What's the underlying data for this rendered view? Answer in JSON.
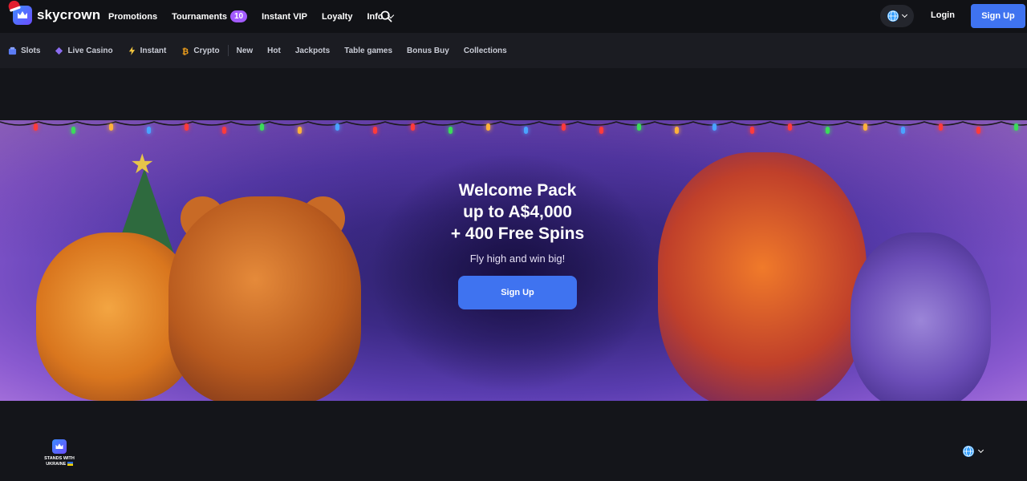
{
  "header": {
    "logo_text": "skycrown",
    "nav": [
      {
        "label": "Promotions"
      },
      {
        "label": "Tournaments",
        "badge": "10"
      },
      {
        "label": "Instant VIP"
      },
      {
        "label": "Loyalty"
      },
      {
        "label": "Info"
      }
    ],
    "login_label": "Login",
    "signup_label": "Sign Up"
  },
  "categories": [
    {
      "label": "Slots",
      "icon": "slots-icon"
    },
    {
      "label": "Live Casino",
      "icon": "live-casino-icon"
    },
    {
      "label": "Instant",
      "icon": "lightning-icon"
    },
    {
      "label": "Crypto",
      "icon": "bitcoin-icon"
    },
    {
      "label": "New"
    },
    {
      "label": "Hot"
    },
    {
      "label": "Jackpots"
    },
    {
      "label": "Table games"
    },
    {
      "label": "Bonus Buy"
    },
    {
      "label": "Collections"
    }
  ],
  "hero": {
    "title_line1": "Welcome Pack",
    "title_line2": "up to A$4,000",
    "title_line3": "+ 400 Free Spins",
    "subtitle": "Fly high and win big!",
    "cta_label": "Sign Up"
  },
  "footer": {
    "ukraine_line1": "STANDS WITH",
    "ukraine_line2": "UKRAINE"
  },
  "colors": {
    "accent": "#3f73f0",
    "badge": "#a35bff",
    "background": "#14151a"
  }
}
